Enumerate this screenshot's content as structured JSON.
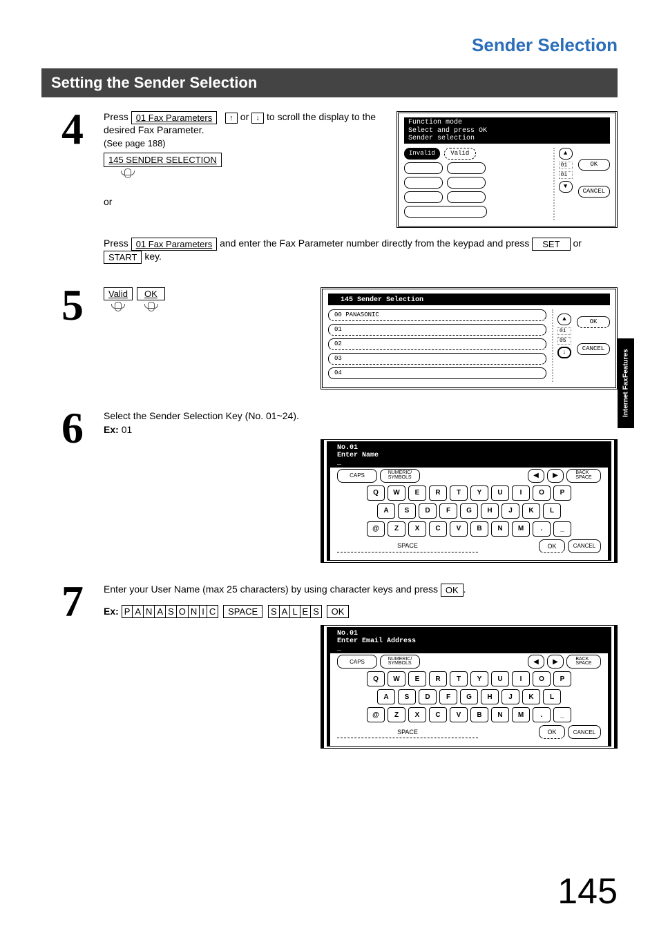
{
  "header": {
    "title": "Sender Selection"
  },
  "section": {
    "heading": "Setting the Sender Selection"
  },
  "steps": {
    "s4": {
      "num": "4",
      "line1a": "Press ",
      "key_faxparams": "01 Fax Parameters",
      "line1b": " or ",
      "line1c": " to scroll the display to the desired Fax Parameter.",
      "see_page": "(See page 188)",
      "param_box": "145 SENDER SELECTION",
      "or": "or",
      "line2a": "Press ",
      "line2b": " and enter the Fax Parameter number directly from the keypad and press ",
      "key_set": "SET",
      "line2c": " or ",
      "key_start": "START",
      "line2d": " key."
    },
    "s5": {
      "num": "5",
      "key_valid": "Valid",
      "key_ok": "OK"
    },
    "s6": {
      "num": "6",
      "text1": "Select the Sender Selection Key (No. 01~24).",
      "ex_label": "Ex:",
      "ex_value": "01"
    },
    "s7": {
      "num": "7",
      "text1": "Enter your User Name (max 25 characters) by using character keys and press ",
      "key_ok": "OK",
      "text1b": ".",
      "ex_label": "Ex:",
      "ex_chars": [
        "P",
        "A",
        "N",
        "A",
        "S",
        "O",
        "N",
        "I",
        "C"
      ],
      "ex_space": "SPACE",
      "ex_chars2": [
        "S",
        "A",
        "L",
        "E",
        "S"
      ],
      "ex_ok": "OK"
    }
  },
  "panels": {
    "p4": {
      "hdr1": "Function mode",
      "hdr2": "Select and press OK",
      "hdr3": "Sender selection",
      "invalid": "Invalid",
      "valid": "Valid",
      "ok": "OK",
      "cancel": "CANCEL",
      "page_top": "01",
      "page_bot": "01"
    },
    "p5": {
      "hdr": "145 Sender Selection",
      "rows": [
        "00  PANASONIC",
        "01",
        "02",
        "03",
        "04"
      ],
      "ok": "OK",
      "cancel": "CANCEL",
      "page_top": "01",
      "page_bot": "05"
    },
    "kb1": {
      "hdr1": "No.01",
      "hdr2": "Enter Name"
    },
    "kb2": {
      "hdr1": "No.01",
      "hdr2": "Enter Email Address"
    },
    "kb_common": {
      "caps": "CAPS",
      "numsym": "NUMERIC/\nSYMBOLS",
      "back": "BACK\nSPACE",
      "row1": [
        "Q",
        "W",
        "E",
        "R",
        "T",
        "Y",
        "U",
        "I",
        "O",
        "P"
      ],
      "row2": [
        "A",
        "S",
        "D",
        "F",
        "G",
        "H",
        "J",
        "K",
        "L"
      ],
      "row3": [
        "@",
        "Z",
        "X",
        "C",
        "V",
        "B",
        "N",
        "M",
        ".",
        "_"
      ],
      "space": "SPACE",
      "ok": "OK",
      "cancel": "CANCEL"
    }
  },
  "side_tab": {
    "line1": "Internet Fax",
    "line2": "Features"
  },
  "page_number": "145"
}
